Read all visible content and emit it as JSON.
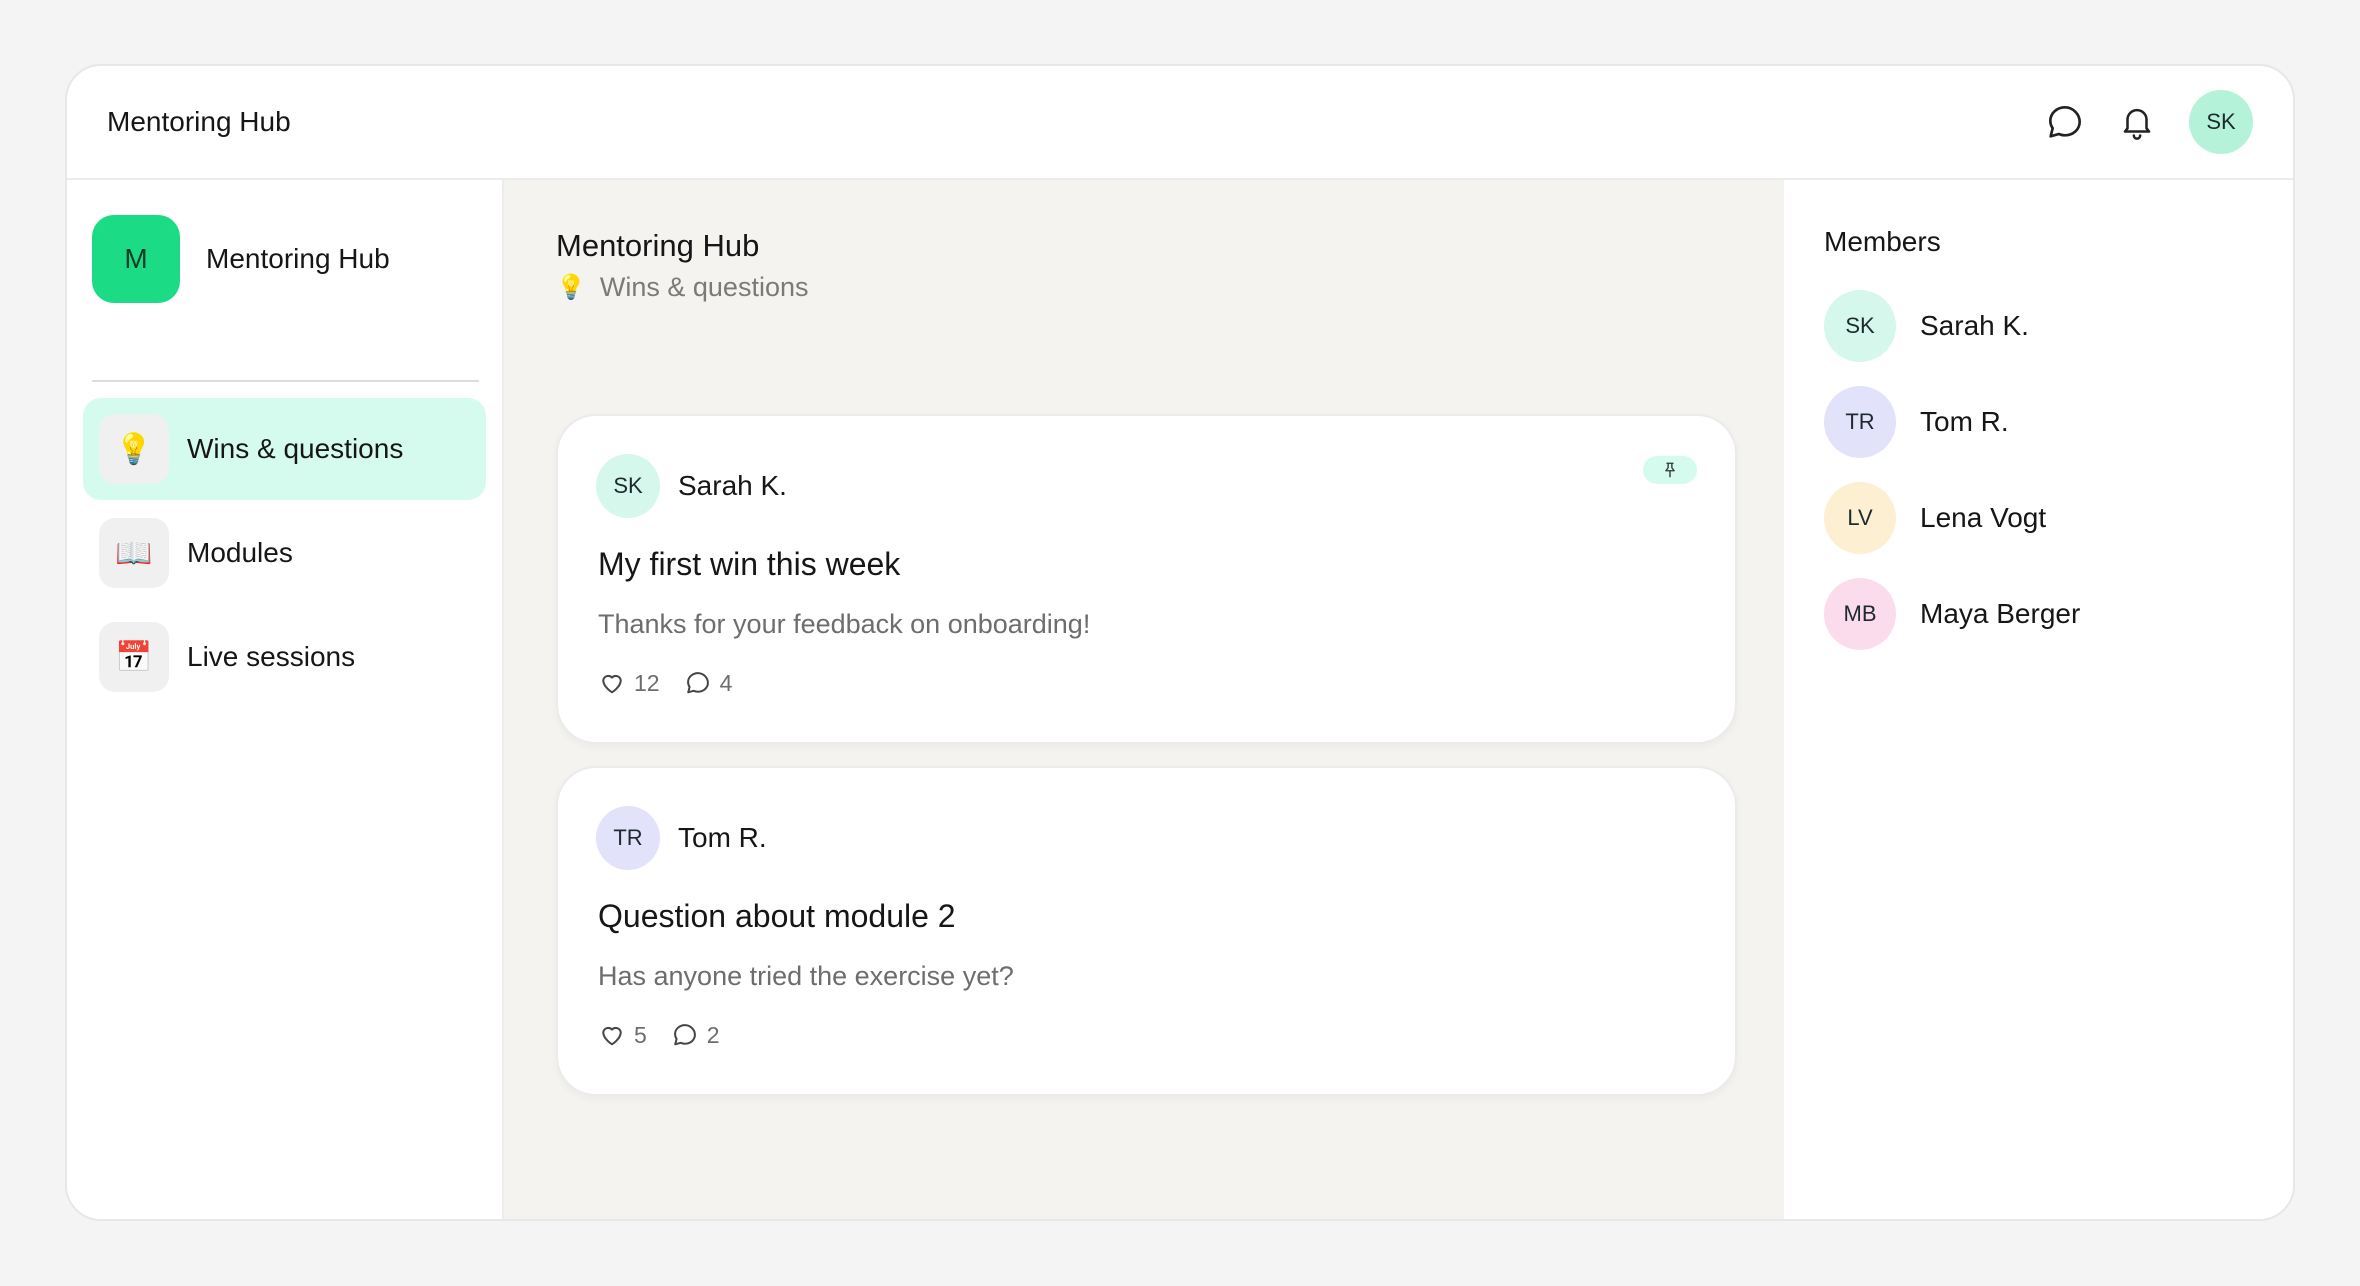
{
  "header": {
    "title": "Mentoring Hub",
    "user_initials": "SK",
    "icons": [
      "chat-bubble-icon",
      "bell-icon"
    ]
  },
  "sidebar": {
    "hub_initial": "M",
    "hub_name": "Mentoring Hub",
    "items": [
      {
        "label": "Wins & questions",
        "icon": "lightbulb-icon",
        "glyph": "💡",
        "active": true
      },
      {
        "label": "Modules",
        "icon": "book-icon",
        "glyph": "📖",
        "active": false
      },
      {
        "label": "Live sessions",
        "icon": "calendar-icon",
        "glyph": "📅",
        "active": false
      }
    ]
  },
  "main": {
    "title": "Mentoring Hub",
    "subtitle": "Wins & questions",
    "subtitle_icon": "💡",
    "posts": [
      {
        "author_initials": "SK",
        "author": "Sarah K.",
        "pinned": true,
        "title": "My first win this week",
        "body": "Thanks for your feedback on onboarding!",
        "likes": "12",
        "comments": "4"
      },
      {
        "author_initials": "TR",
        "author": "Tom R.",
        "pinned": false,
        "title": "Question about module 2",
        "body": "Has anyone tried the exercise yet?",
        "likes": "5",
        "comments": "2"
      }
    ]
  },
  "members": {
    "title": "Members",
    "list": [
      {
        "initials": "SK",
        "name": "Sarah K.",
        "color": "#d5f7ec"
      },
      {
        "initials": "TR",
        "name": "Tom R.",
        "color": "#e3e2fb"
      },
      {
        "initials": "LV",
        "name": "Lena Vogt",
        "color": "#fdf0d2"
      },
      {
        "initials": "MB",
        "name": "Maya Berger",
        "color": "#fbdcec"
      }
    ]
  },
  "colors": {
    "accent": "#1bdc85",
    "active_bg": "#d4fbee",
    "top_avatar": "#b4f3d9",
    "canvas": "#f4f3f0"
  }
}
